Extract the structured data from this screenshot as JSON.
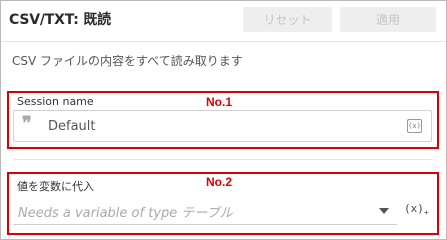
{
  "header": {
    "title": "CSV/TXT: 既読",
    "reset_label": "リセット",
    "apply_label": "適用"
  },
  "description": "CSV ファイルの内容をすべて読み取ります",
  "fields": {
    "session_name": {
      "label": "Session name",
      "value": "Default",
      "quote_icon": "quote-icon",
      "fx_icon": "(x)"
    },
    "assign_variable": {
      "label": "値を変数に代入",
      "placeholder": "Needs a variable of type テーブル",
      "fx_icon": "(x)",
      "fx_plus": "+"
    }
  },
  "annotations": {
    "box1_label": "No.1",
    "box2_label": "No.2",
    "color": "#d90000"
  }
}
